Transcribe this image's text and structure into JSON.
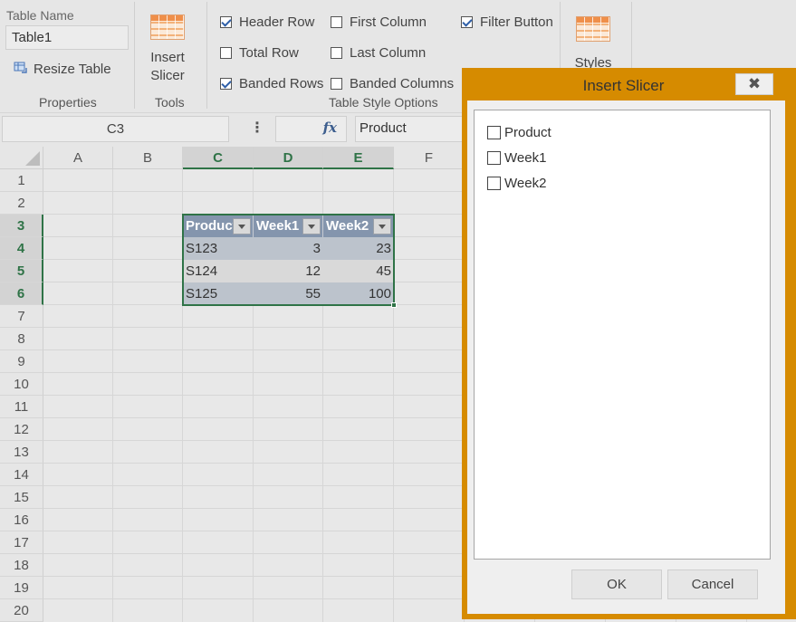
{
  "ribbon": {
    "table_name_label": "Table Name",
    "table_name_value": "Table1",
    "resize_table": "Resize Table",
    "properties_label": "Properties",
    "insert_slicer_line1": "Insert",
    "insert_slicer_line2": "Slicer",
    "tools_label": "Tools",
    "styles_label": "Styles",
    "style_options_label": "Table Style Options",
    "options": [
      {
        "label": "Header Row",
        "checked": true
      },
      {
        "label": "Total Row",
        "checked": false
      },
      {
        "label": "Banded Rows",
        "checked": true
      },
      {
        "label": "First Column",
        "checked": false
      },
      {
        "label": "Last Column",
        "checked": false
      },
      {
        "label": "Banded Columns",
        "checked": false
      },
      {
        "label": "Filter Button",
        "checked": true
      }
    ]
  },
  "formula_bar": {
    "name_box": "C3",
    "more_icon": "⋮",
    "fx_icon": "fx",
    "formula": "Product"
  },
  "grid": {
    "columns": [
      "A",
      "B",
      "C",
      "D",
      "E",
      "F"
    ],
    "rows": [
      "1",
      "2",
      "3",
      "4",
      "5",
      "6",
      "7",
      "8",
      "9",
      "10",
      "11",
      "12",
      "13",
      "14",
      "15",
      "16",
      "17",
      "18",
      "19",
      "20"
    ]
  },
  "table": {
    "headers": [
      "Product",
      "Week1",
      "Week2"
    ],
    "rows": [
      [
        "S123",
        "3",
        "23"
      ],
      [
        "S124",
        "12",
        "45"
      ],
      [
        "S125",
        "55",
        "100"
      ]
    ]
  },
  "dialog": {
    "title": "Insert Slicer",
    "close_icon": "✖",
    "items": [
      {
        "label": "Product",
        "checked": false
      },
      {
        "label": "Week1",
        "checked": false
      },
      {
        "label": "Week2",
        "checked": false
      }
    ],
    "ok_label": "OK",
    "cancel_label": "Cancel"
  },
  "colors": {
    "accent_green": "#2f7347",
    "dialog_border": "#d68b00",
    "table_header": "#8495ad",
    "table_band": "#bcc3cc"
  }
}
